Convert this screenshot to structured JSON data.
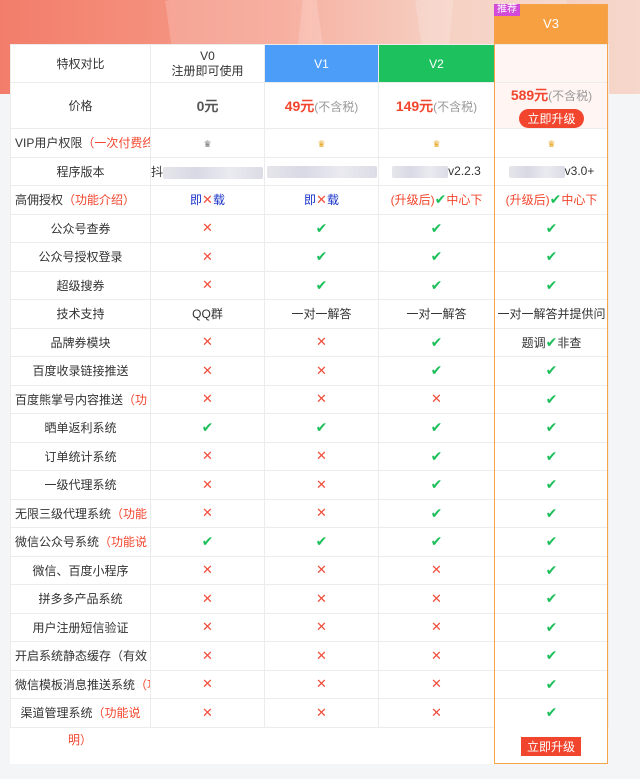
{
  "header": {
    "tag": "推荐",
    "col_label": "特权对比",
    "v0": "V0",
    "v0_sub": "注册即可使用",
    "v1": "V1",
    "v2": "V2",
    "v3": "V3"
  },
  "price": {
    "label": "价格",
    "v0": "0元",
    "v1": "49元",
    "v2": "149元",
    "v3": "589元",
    "note": "(不含税)",
    "upgrade": "立即升级"
  },
  "rows": {
    "vip": {
      "label": "VIP用户权限",
      "note": "（一次付费终"
    },
    "version": {
      "label": "程序版本",
      "v0_prefix": "抖",
      "v2": "v2.2.3",
      "v3": "v3.0+"
    },
    "yongjin": {
      "label": "高佣授权",
      "note": "（功能介绍）",
      "v0": "即",
      "v0_tail": "载",
      "v1": "即",
      "v1_tail": "载",
      "v2_pre": "(升级后)",
      "v2_tail": "中心下",
      "v3_pre": "(升级后)",
      "v3_tail": "中心下"
    },
    "r4": {
      "label": "公众号查券"
    },
    "r5": {
      "label": "公众号授权登录"
    },
    "r6": {
      "label": "超级搜券"
    },
    "support": {
      "label": "技术支持",
      "v0": "QQ群",
      "v1": "一对一解答",
      "v2": "一对一解答",
      "v3": "一对一解答并提供问"
    },
    "brand": {
      "label": "品牌券模块",
      "v3_pre": "题调",
      "v3_tail": "非查"
    },
    "r9": {
      "label": "百度收录链接推送"
    },
    "r10": {
      "label": "百度熊掌号内容推送",
      "note": "（功"
    },
    "r11": {
      "label": "晒单返利系统"
    },
    "r12": {
      "label": "订单统计系统"
    },
    "r13": {
      "label": "一级代理系统"
    },
    "r14": {
      "label": "无限三级代理系统",
      "note": "（功能"
    },
    "r15": {
      "label": "微信公众号系统",
      "note": "（功能说"
    },
    "r16": {
      "label": "微信、百度小程序"
    },
    "r17": {
      "label": "拼多多产品系统"
    },
    "r18": {
      "label": "用户注册短信验证"
    },
    "r19": {
      "label": "开启系统静态缓存（有效"
    },
    "r20": {
      "label": "微信模板消息推送系统",
      "note": "（功"
    },
    "r21": {
      "label": "渠道管理系统",
      "note": "（功能说",
      "cont": "明）"
    }
  },
  "icons": {
    "check": "✔",
    "cross": "✕",
    "crown": "♛"
  },
  "bottom": {
    "upgrade": "立即升级"
  },
  "colors": {
    "v1": "#4c9df7",
    "v2": "#1dc25f",
    "v3": "#f7a042",
    "accent": "#f2452d"
  }
}
